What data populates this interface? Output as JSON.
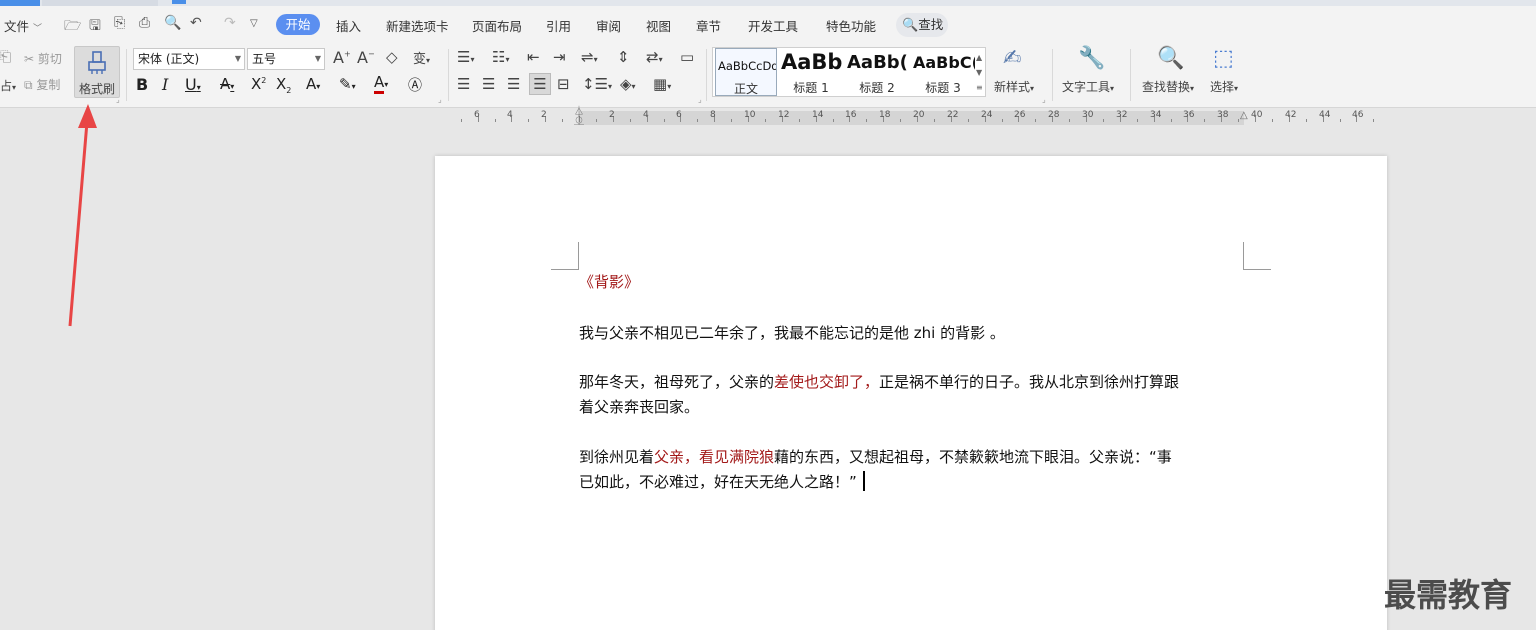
{
  "menubar": {
    "file": "文件",
    "tabs": [
      "开始",
      "插入",
      "新建选项卡",
      "页面布局",
      "引用",
      "审阅",
      "视图",
      "章节",
      "开发工具",
      "特色功能"
    ],
    "search": "查找"
  },
  "ribbon": {
    "cut": "剪切",
    "copy": "复制",
    "paste_partial": "占",
    "format_painter": "格式刷",
    "font_name": "宋体 (正文)",
    "font_size": "五号",
    "styles": [
      {
        "preview": "AaBbCcDd",
        "name": "正文"
      },
      {
        "preview": "AaBb",
        "name": "标题 1"
      },
      {
        "preview": "AaBb(",
        "name": "标题 2"
      },
      {
        "preview": "AaBbC(",
        "name": "标题 3"
      }
    ],
    "new_style": "新样式",
    "text_tools": "文字工具",
    "find_replace": "查找替换",
    "select": "选择"
  },
  "ruler": {
    "labels": [
      "6",
      "4",
      "2",
      "2",
      "4",
      "6",
      "8",
      "10",
      "12",
      "14",
      "16",
      "18",
      "20",
      "22",
      "24",
      "26",
      "28",
      "30",
      "32",
      "34",
      "36",
      "38",
      "40",
      "42",
      "44",
      "46"
    ]
  },
  "document": {
    "title": "《背影》",
    "p1": "我与父亲不相见已二年余了，我最不能忘记的是他 zhi 的背影 。",
    "p2a": "那年冬天，祖母死了，父亲的",
    "p2b": "差使也交卸了，",
    "p2c": "正是祸不单行的日子。我从北京到徐州打算跟",
    "p2d": "着父亲奔丧回家。",
    "p3a": "到徐州见着",
    "p3b": "父亲，看见满院狼",
    "p3c": "藉的东西，又想起祖母，不禁簌簌地流下眼泪。父亲说：“事",
    "p3d": "已如此，不必难过，好在天无绝人之路！”"
  },
  "watermark": "最需教育",
  "colors": {
    "accent": "#5b8ff0",
    "annotation_arrow": "#e84545",
    "highlight_text": "#a31a1a"
  }
}
